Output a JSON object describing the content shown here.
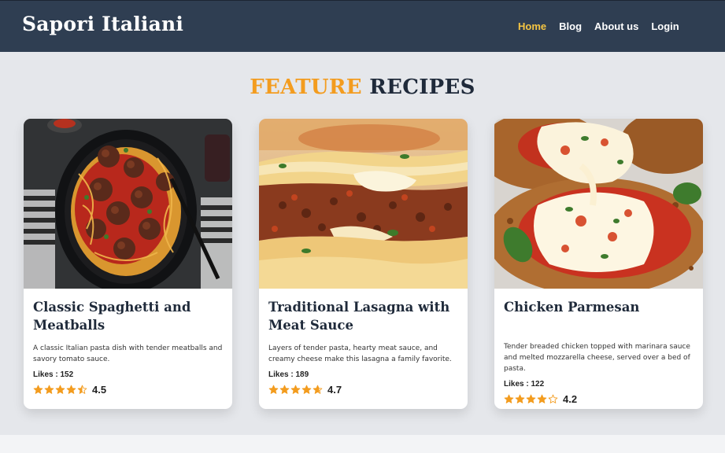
{
  "navbar": {
    "brand": "Sapori Italiani",
    "links": [
      {
        "label": "Home",
        "active": true
      },
      {
        "label": "Blog",
        "active": false
      },
      {
        "label": "About us",
        "active": false
      },
      {
        "label": "Login",
        "active": false
      }
    ]
  },
  "section": {
    "title_accent": "FEATURE",
    "title_main": "RECIPES"
  },
  "colors": {
    "navbar_bg": "#2f3e52",
    "accent": "#f39c1f",
    "active_link": "#f5c542",
    "star": "#f39c1f"
  },
  "recipes": [
    {
      "title": "Classic Spaghetti and Meatballs",
      "description": "A classic Italian pasta dish with tender meatballs and savory tomato sauce.",
      "likes_label": "Likes : 152",
      "rating": 4.5,
      "rating_text": "4.5",
      "image_icon": "spaghetti-meatballs-photo"
    },
    {
      "title": "Traditional Lasagna with Meat Sauce",
      "description": "Layers of tender pasta, hearty meat sauce, and creamy cheese make this lasagna a family favorite.",
      "likes_label": "Likes : 189",
      "rating": 4.7,
      "rating_text": "4.7",
      "image_icon": "lasagna-photo"
    },
    {
      "title": "Chicken Parmesan",
      "description": "Tender breaded chicken topped with marinara sauce and melted mozzarella cheese, served over a bed of pasta.",
      "likes_label": "Likes : 122",
      "rating": 4.2,
      "rating_text": "4.2",
      "image_icon": "chicken-parmesan-photo"
    }
  ]
}
